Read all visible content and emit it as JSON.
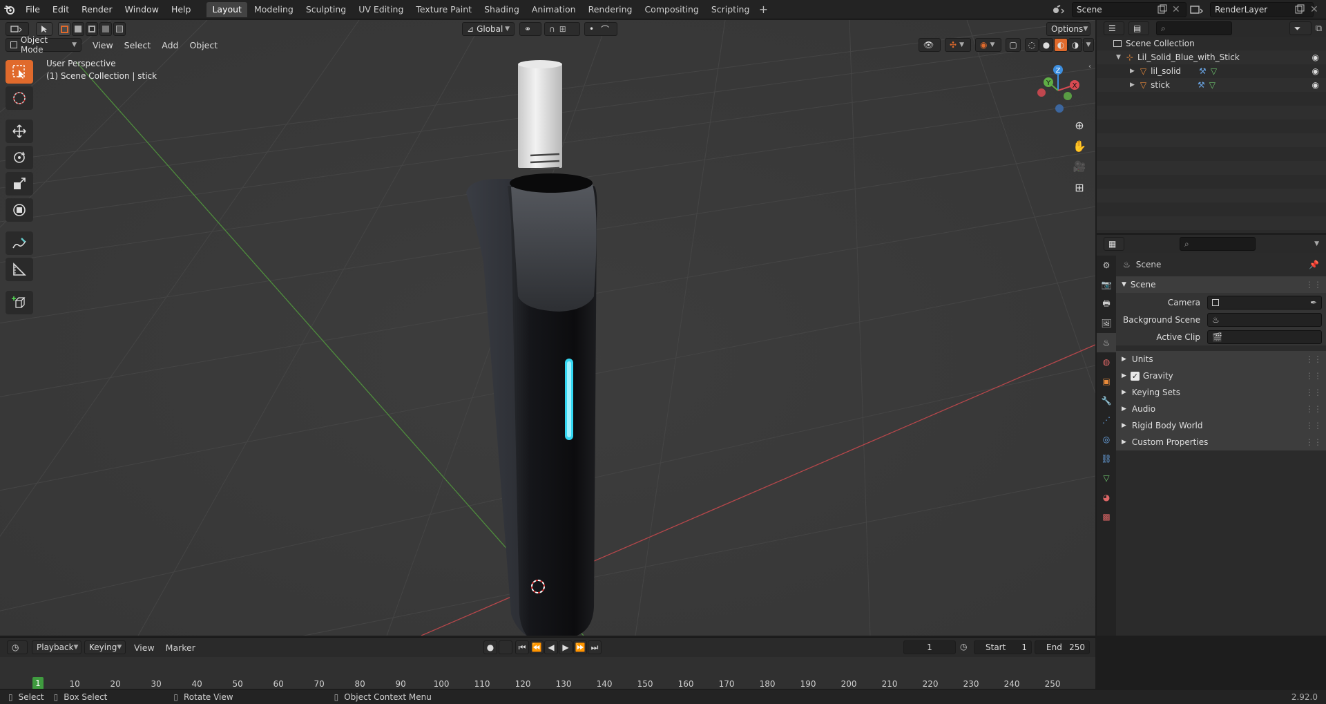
{
  "app": {
    "menu": [
      "File",
      "Edit",
      "Render",
      "Window",
      "Help"
    ],
    "workspaces": [
      {
        "label": "Layout",
        "active": true
      },
      {
        "label": "Modeling"
      },
      {
        "label": "Sculpting"
      },
      {
        "label": "UV Editing"
      },
      {
        "label": "Texture Paint"
      },
      {
        "label": "Shading"
      },
      {
        "label": "Animation"
      },
      {
        "label": "Rendering"
      },
      {
        "label": "Compositing"
      },
      {
        "label": "Scripting"
      }
    ],
    "add_tab": "+",
    "scene_name": "Scene",
    "view_layer": "RenderLayer"
  },
  "viewport": {
    "mode": "Object Mode",
    "menu": [
      "View",
      "Select",
      "Add",
      "Object"
    ],
    "transform_orientation": "Global",
    "options_label": "Options",
    "overlay_line1": "User Perspective",
    "overlay_line2": "(1) Scene Collection | stick",
    "gizmo": {
      "x": "X",
      "y": "Y",
      "z": "Z"
    },
    "colors": {
      "bg": "#393939",
      "grid": "#4a4a4a",
      "x_axis": "#c4494d",
      "y_axis": "#5c9b45",
      "active_tool": "#e06a2c",
      "light_bar": "#35d7f2"
    }
  },
  "outliner": {
    "root": "Scene Collection",
    "collection": "Lil_Solid_Blue_with_Stick",
    "objects": [
      {
        "name": "lil_solid"
      },
      {
        "name": "stick"
      }
    ]
  },
  "properties": {
    "context_title": "Scene",
    "panel_title": "Scene",
    "fields": [
      {
        "label": "Camera",
        "value": ""
      },
      {
        "label": "Background Scene",
        "value": ""
      },
      {
        "label": "Active Clip",
        "value": ""
      }
    ],
    "subpanels": [
      {
        "label": "Units"
      },
      {
        "label": "Gravity",
        "checkbox": true,
        "checked": true
      },
      {
        "label": "Keying Sets"
      },
      {
        "label": "Audio"
      },
      {
        "label": "Rigid Body World"
      },
      {
        "label": "Custom Properties"
      }
    ]
  },
  "timeline": {
    "menus": [
      "Playback",
      "Keying",
      "View",
      "Marker"
    ],
    "current_frame": "1",
    "start_label": "Start",
    "start_value": "1",
    "end_label": "End",
    "end_value": "250",
    "ticks": [
      "1",
      "10",
      "20",
      "30",
      "40",
      "50",
      "60",
      "70",
      "80",
      "90",
      "100",
      "110",
      "120",
      "130",
      "140",
      "150",
      "160",
      "170",
      "180",
      "190",
      "200",
      "210",
      "220",
      "230",
      "240",
      "250"
    ]
  },
  "statusbar": {
    "select": "Select",
    "box_select": "Box Select",
    "rotate_view": "Rotate View",
    "context_menu": "Object Context Menu",
    "version": "2.92.0"
  }
}
